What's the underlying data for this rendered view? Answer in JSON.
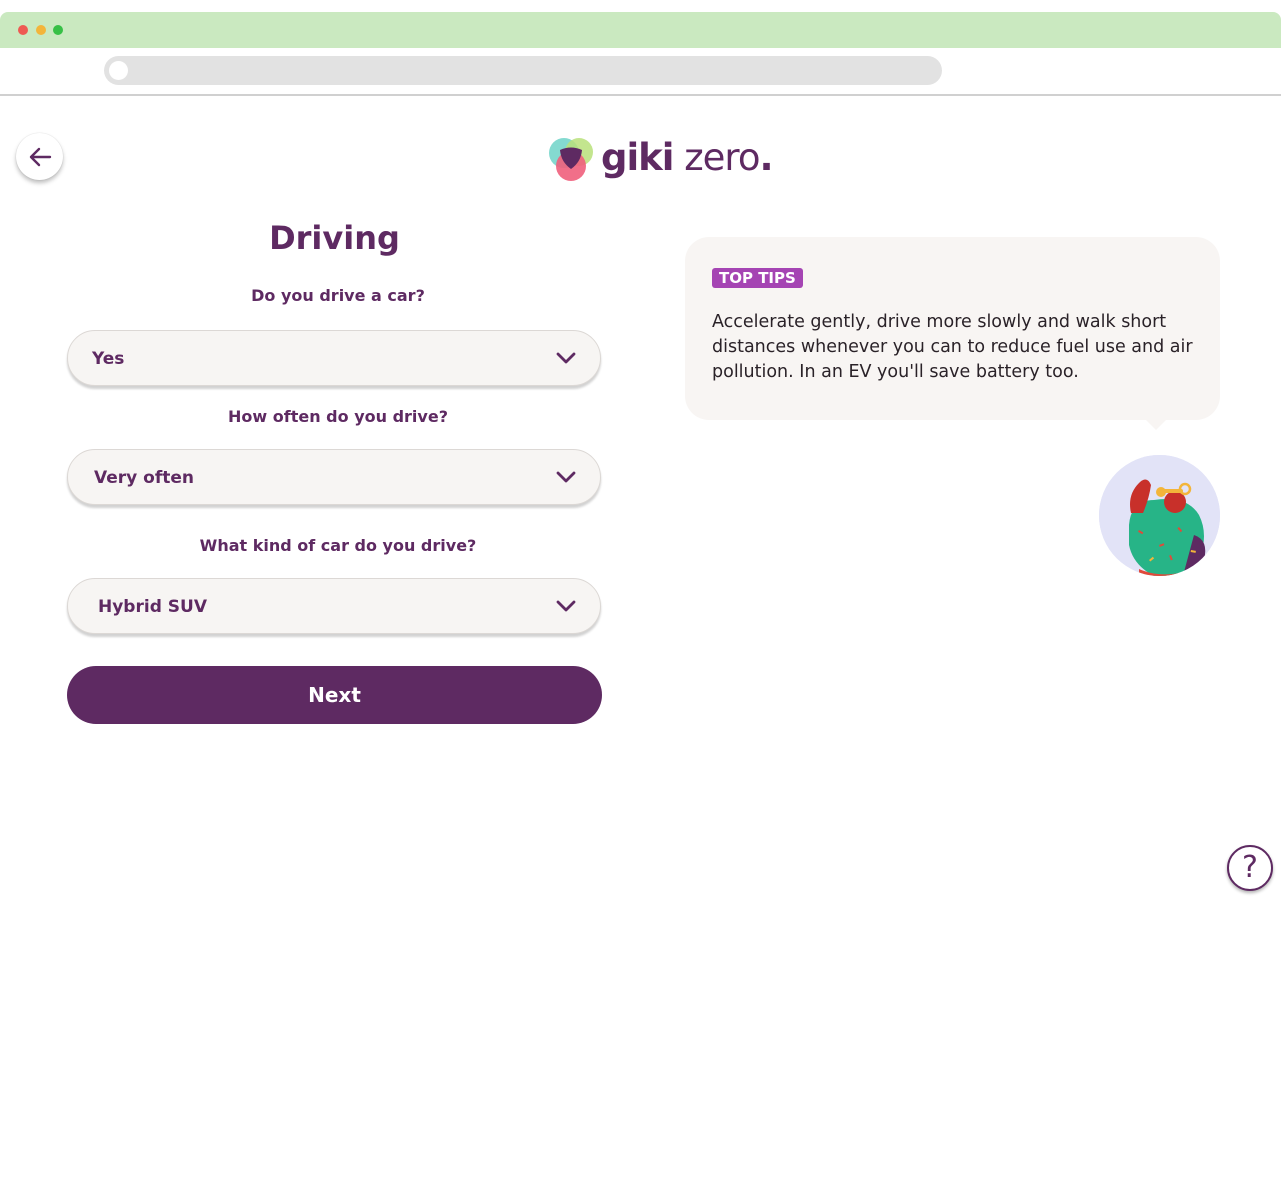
{
  "brand": {
    "name_part1": "giki",
    "name_part2": " zero",
    "name_dot": ".",
    "color_primary": "#5e2a62",
    "color_badge": "#a544b3"
  },
  "header": {
    "back_icon": "arrow-left-icon"
  },
  "form": {
    "title": "Driving",
    "questions": [
      {
        "label": "Do you drive a car?",
        "value": "Yes"
      },
      {
        "label": "How often do you drive?",
        "value": "Very often"
      },
      {
        "label": "What kind of car do you drive?",
        "value": "Hybrid SUV"
      }
    ],
    "next_label": "Next"
  },
  "tips": {
    "badge": "TOP TIPS",
    "text": "Accelerate gently, drive more slowly and walk short distances whenever you can to reduce fuel use and air pollution. In an EV you'll save battery too."
  },
  "help": {
    "label": "?",
    "icon": "help-icon"
  }
}
